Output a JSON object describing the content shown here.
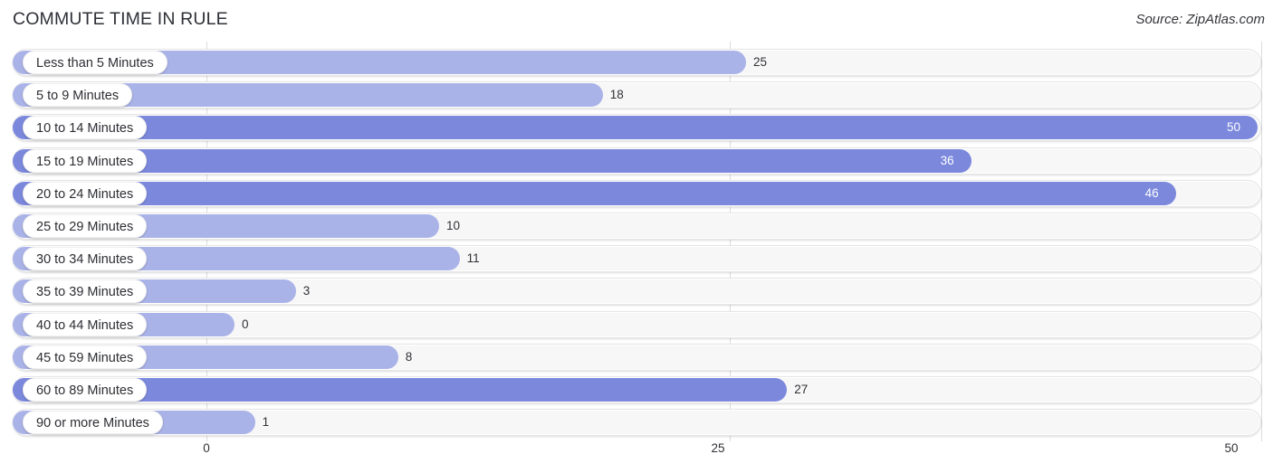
{
  "header": {
    "title": "COMMUTE TIME IN RULE",
    "source": "Source: ZipAtlas.com"
  },
  "axis": {
    "ticks": [
      "0",
      "25",
      "50"
    ],
    "min": 0,
    "max": 50
  },
  "colors": {
    "bar_dark": "#7b88dc",
    "bar_light": "#aab3e8",
    "track": "#f7f7f7",
    "gridline": "#dcdcdc",
    "text": "#2f3032"
  },
  "chart_data": {
    "type": "bar",
    "orientation": "horizontal",
    "title": "COMMUTE TIME IN RULE",
    "subtitle": "Source: ZipAtlas.com",
    "xlabel": "",
    "ylabel": "",
    "xlim": [
      0,
      50
    ],
    "grid": true,
    "legend": "none",
    "categories": [
      "Less than 5 Minutes",
      "5 to 9 Minutes",
      "10 to 14 Minutes",
      "15 to 19 Minutes",
      "20 to 24 Minutes",
      "25 to 29 Minutes",
      "30 to 34 Minutes",
      "35 to 39 Minutes",
      "40 to 44 Minutes",
      "45 to 59 Minutes",
      "60 to 89 Minutes",
      "90 or more Minutes"
    ],
    "values": [
      25,
      18,
      50,
      36,
      46,
      10,
      11,
      3,
      0,
      8,
      27,
      1
    ],
    "value_labels": [
      "25",
      "18",
      "50",
      "36",
      "46",
      "10",
      "11",
      "3",
      "0",
      "8",
      "27",
      "1"
    ],
    "tick_labels": [
      "0",
      "25",
      "50"
    ]
  },
  "bars": [
    {
      "label": "Less than 5 Minutes",
      "value": 25,
      "value_label": "25",
      "inside": false,
      "shade": "light"
    },
    {
      "label": "5 to 9 Minutes",
      "value": 18,
      "value_label": "18",
      "inside": false,
      "shade": "light"
    },
    {
      "label": "10 to 14 Minutes",
      "value": 50,
      "value_label": "50",
      "inside": true,
      "shade": "dark"
    },
    {
      "label": "15 to 19 Minutes",
      "value": 36,
      "value_label": "36",
      "inside": true,
      "shade": "dark"
    },
    {
      "label": "20 to 24 Minutes",
      "value": 46,
      "value_label": "46",
      "inside": true,
      "shade": "dark"
    },
    {
      "label": "25 to 29 Minutes",
      "value": 10,
      "value_label": "10",
      "inside": false,
      "shade": "light"
    },
    {
      "label": "30 to 34 Minutes",
      "value": 11,
      "value_label": "11",
      "inside": false,
      "shade": "light"
    },
    {
      "label": "35 to 39 Minutes",
      "value": 3,
      "value_label": "3",
      "inside": false,
      "shade": "light"
    },
    {
      "label": "40 to 44 Minutes",
      "value": 0,
      "value_label": "0",
      "inside": false,
      "shade": "light"
    },
    {
      "label": "45 to 59 Minutes",
      "value": 8,
      "value_label": "8",
      "inside": false,
      "shade": "light"
    },
    {
      "label": "60 to 89 Minutes",
      "value": 27,
      "value_label": "27",
      "inside": false,
      "shade": "dark"
    },
    {
      "label": "90 or more Minutes",
      "value": 1,
      "value_label": "1",
      "inside": false,
      "shade": "light"
    }
  ]
}
